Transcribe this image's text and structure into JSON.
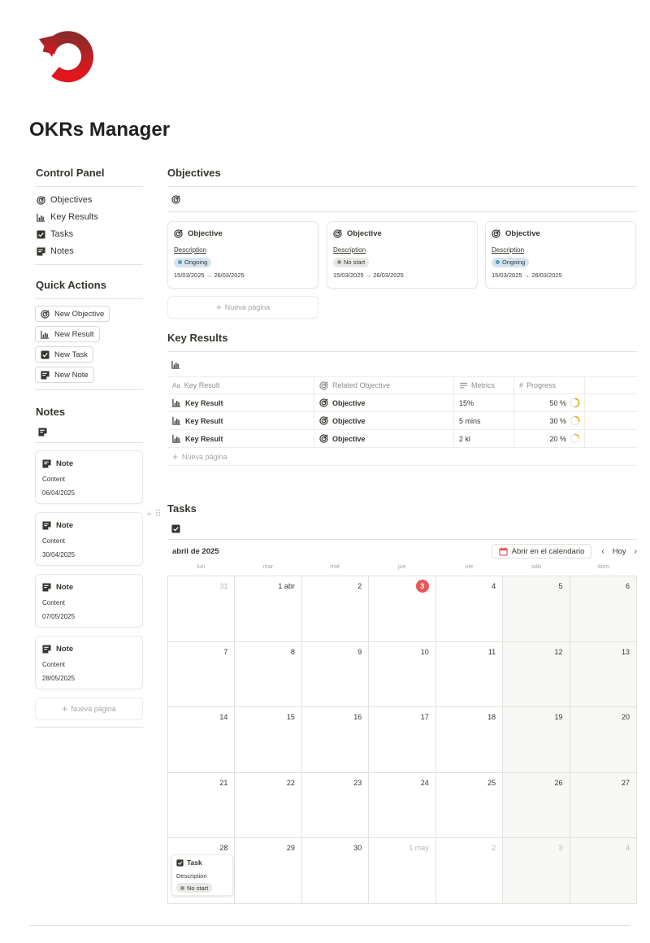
{
  "page": {
    "title": "OKRs Manager"
  },
  "colors": {
    "logo_gradient_top": "#8e2a2a",
    "logo_gradient_bottom": "#e4161c",
    "ongoing_bg": "#d3e5ef",
    "ongoing_dot": "#5b97bd",
    "nostart_bg": "#e9e9e7",
    "nostart_dot": "#91918e",
    "today": "#eb5757",
    "progress_ring": "#dfab01"
  },
  "sidebar": {
    "control_panel": {
      "title": "Control Panel",
      "items": [
        {
          "label": "Objectives",
          "icon": "target-icon"
        },
        {
          "label": "Key Results",
          "icon": "chart-icon"
        },
        {
          "label": "Tasks",
          "icon": "checkbox-icon"
        },
        {
          "label": "Notes",
          "icon": "note-icon"
        }
      ]
    },
    "quick_actions": {
      "title": "Quick Actions",
      "buttons": [
        {
          "label": "New Objective",
          "icon": "target-icon"
        },
        {
          "label": "New Result",
          "icon": "chart-icon"
        },
        {
          "label": "New Task",
          "icon": "checkbox-icon"
        },
        {
          "label": "New Note",
          "icon": "note-icon"
        }
      ]
    },
    "notes": {
      "title": "Notes",
      "cards": [
        {
          "title": "Note",
          "content": "Content",
          "date": "06/04/2025"
        },
        {
          "title": "Note",
          "content": "Content",
          "date": "30/04/2025"
        },
        {
          "title": "Note",
          "content": "Content",
          "date": "07/05/2025"
        },
        {
          "title": "Note",
          "content": "Content",
          "date": "28/05/2025"
        }
      ],
      "add_label": "Nueva página"
    }
  },
  "objectives": {
    "title": "Objectives",
    "cards": [
      {
        "title": "Objective",
        "desc_label": "Description",
        "status": "Ongoing",
        "dates": "15/03/2025 → 26/03/2025"
      },
      {
        "title": "Objective",
        "desc_label": "Description",
        "status": "No start",
        "dates": "15/03/2025 → 26/03/2025"
      },
      {
        "title": "Objective",
        "desc_label": "Description",
        "status": "Ongoing",
        "dates": "15/03/2025 → 26/03/2025"
      }
    ],
    "add_label": "Nueva página"
  },
  "key_results": {
    "title": "Key Results",
    "columns": [
      {
        "label": "Key Result",
        "icon_text": "Aa"
      },
      {
        "label": "Related Objective"
      },
      {
        "label": "Metrics"
      },
      {
        "label": "Progress",
        "icon_text": "#"
      }
    ],
    "rows": [
      {
        "name": "Key Result",
        "objective": "Objective",
        "metric": "15%",
        "progress_label": "50 %",
        "progress": 0.5
      },
      {
        "name": "Key Result",
        "objective": "Objective",
        "metric": "5 mins",
        "progress_label": "30 %",
        "progress": 0.3
      },
      {
        "name": "Key Result",
        "objective": "Objective",
        "metric": "2 kl",
        "progress_label": "20 %",
        "progress": 0.2
      }
    ],
    "add_label": "Nueva página"
  },
  "tasks": {
    "title": "Tasks",
    "month": "abril de 2025",
    "open_calendar": "Abrir en el calendario",
    "today_btn": "Hoy",
    "weekdays": [
      "lun",
      "mar",
      "mié",
      "jue",
      "vie",
      "sáb",
      "dom"
    ],
    "days": [
      "31",
      "1 abr",
      "2",
      "3",
      "4",
      "5",
      "6",
      "7",
      "8",
      "9",
      "10",
      "11",
      "12",
      "13",
      "14",
      "15",
      "16",
      "17",
      "18",
      "19",
      "20",
      "21",
      "22",
      "23",
      "24",
      "25",
      "26",
      "27",
      "28",
      "29",
      "30",
      "1 may",
      "2",
      "3",
      "4"
    ],
    "task": {
      "title": "Task",
      "desc": "Description",
      "status": "No start"
    }
  }
}
